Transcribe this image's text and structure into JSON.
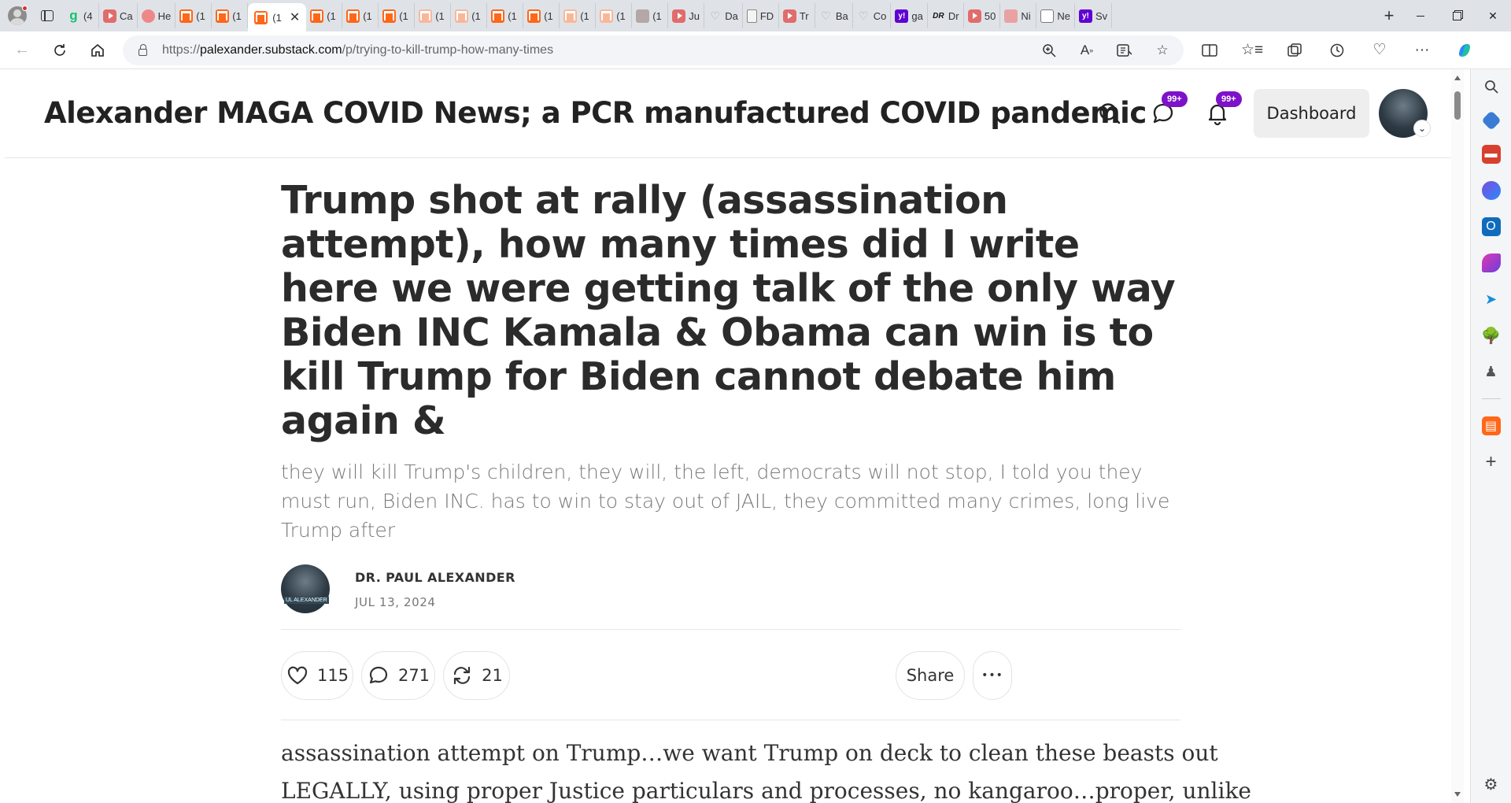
{
  "browser": {
    "tabs": [
      {
        "icon": "gmail-g-icon",
        "label": "(4"
      },
      {
        "icon": "youtube-icon",
        "label": "Ca"
      },
      {
        "icon": "podcast-icon",
        "label": "He"
      },
      {
        "icon": "substack-icon",
        "label": "(1"
      },
      {
        "icon": "substack-icon",
        "label": "(1"
      },
      {
        "icon": "substack-icon",
        "label": "(1",
        "active": true
      },
      {
        "icon": "substack-icon",
        "label": "(1"
      },
      {
        "icon": "substack-icon",
        "label": "(1"
      },
      {
        "icon": "substack-icon",
        "label": "(1"
      },
      {
        "icon": "substack-pale-icon",
        "label": "(1"
      },
      {
        "icon": "substack-pale-icon",
        "label": "(1"
      },
      {
        "icon": "substack-icon",
        "label": "(1"
      },
      {
        "icon": "substack-icon",
        "label": "(1"
      },
      {
        "icon": "substack-pale-icon",
        "label": "(1"
      },
      {
        "icon": "substack-pale-icon",
        "label": "(1"
      },
      {
        "icon": "photo-icon",
        "label": "(1"
      },
      {
        "icon": "youtube-icon",
        "label": "Ju"
      },
      {
        "icon": "heartbeat-icon",
        "label": "Da"
      },
      {
        "icon": "document-icon",
        "label": "FD"
      },
      {
        "icon": "youtube-icon",
        "label": "Tr"
      },
      {
        "icon": "heartbeat-icon",
        "label": "Ba"
      },
      {
        "icon": "heartbeat-icon",
        "label": "Co"
      },
      {
        "icon": "yahoo-icon",
        "label": "ga"
      },
      {
        "icon": "dr-icon",
        "label": "Dr"
      },
      {
        "icon": "youtube-icon",
        "label": "50"
      },
      {
        "icon": "pink-icon",
        "label": "Ni"
      },
      {
        "icon": "newsletter-icon",
        "label": "Ne"
      },
      {
        "icon": "yahoo-icon",
        "label": "Sv"
      }
    ],
    "url_prefix": "https://",
    "url_host": "palexander.substack.com",
    "url_path": "/p/trying-to-kill-trump-how-many-times"
  },
  "site": {
    "title": "Alexander MAGA COVID News; a PCR manufactured COVID pandemic",
    "chat_badge": "99+",
    "notif_badge": "99+",
    "dashboard_label": "Dashboard"
  },
  "article": {
    "title": "Trump shot at rally (assassination attempt), how many times did I write here we were getting talk of the only way Biden INC Kamala & Obama can win is to kill Trump for Biden cannot debate him again &",
    "subtitle": "they will kill Trump's children, they will, the left, democrats will not stop, I told you they must run, Biden INC. has to win to stay out of JAIL, they committed many crimes, long live Trump after",
    "author": "DR. PAUL ALEXANDER",
    "avatar_caption": "UL ALEXANDER",
    "date": "JUL 13, 2024",
    "likes": "115",
    "comments": "271",
    "restacks": "21",
    "share_label": "Share",
    "more_label": "•••",
    "body_lines": [
      "assassination attempt on Trump…we want Trump on deck to clean these beasts out",
      "LEGALLY, using proper Justice particulars and processes, no kangaroo…proper, unlike"
    ]
  },
  "colors": {
    "badge": "#7e12c9",
    "substack_orange": "#ff6719"
  }
}
